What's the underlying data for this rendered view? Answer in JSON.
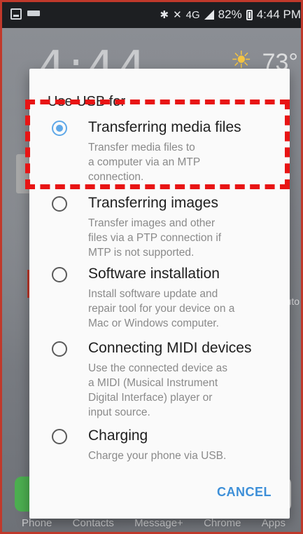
{
  "status_bar": {
    "bluetooth_icon": "bluetooth-icon",
    "mute_icon": "mute-icon",
    "network": "4G",
    "battery": "82%",
    "time": "4:44 PM"
  },
  "home": {
    "clock": "4:44",
    "temperature": "73°",
    "side_text": "uto",
    "dock": [
      "Phone",
      "Contacts",
      "Message+",
      "Chrome",
      "Apps"
    ]
  },
  "dialog": {
    "title": "Use USB for",
    "options": [
      {
        "title": "Transferring media files",
        "desc": [
          "Transfer media files to",
          "a computer via an MTP",
          "connection."
        ],
        "selected": true
      },
      {
        "title": "Transferring images",
        "desc": [
          "Transfer images and other",
          "files via a PTP connection if",
          "MTP is not supported."
        ],
        "selected": false
      },
      {
        "title": "Software installation",
        "desc": [
          "Install software update and",
          "repair tool for your device on a",
          "Mac or Windows computer."
        ],
        "selected": false
      },
      {
        "title": "Connecting MIDI devices",
        "desc": [
          "Use the connected device as",
          "a MIDI (Musical Instrument",
          "Digital Interface) player or",
          "input source."
        ],
        "selected": false
      },
      {
        "title": "Charging",
        "desc": [
          "Charge your phone via USB."
        ],
        "selected": false
      }
    ],
    "cancel_label": "CANCEL"
  },
  "colors": {
    "accent": "#3d8fd8",
    "radio_selected": "#5fa8e8",
    "highlight": "#e81414"
  }
}
